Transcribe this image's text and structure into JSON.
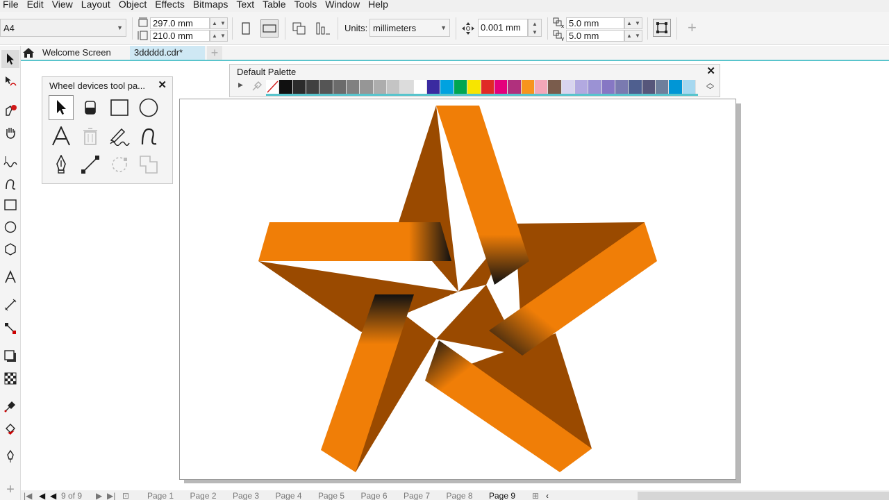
{
  "menu": [
    "File",
    "Edit",
    "View",
    "Layout",
    "Object",
    "Effects",
    "Bitmaps",
    "Text",
    "Table",
    "Tools",
    "Window",
    "Help"
  ],
  "propbar": {
    "page_size": "A4",
    "width": "297.0 mm",
    "height": "210.0 mm",
    "units_label": "Units:",
    "units_value": "millimeters",
    "nudge": "0.001 mm",
    "dup_x": "5.0 mm",
    "dup_y": "5.0 mm"
  },
  "doc_tabs": {
    "welcome": "Welcome Screen",
    "file": "3ddddd.cdr*",
    "add": "+"
  },
  "palette": {
    "title": "Default Palette",
    "colors": [
      "#ffffff",
      "#101010",
      "#2b2b2b",
      "#404040",
      "#555555",
      "#6b6b6b",
      "#808080",
      "#969696",
      "#adadad",
      "#c4c4c4",
      "#dcdcdc",
      "#ffffff",
      "#3a2aa0",
      "#00a2e0",
      "#00a651",
      "#f7e500",
      "#e02a26",
      "#e4007c",
      "#b0307d",
      "#f7941d",
      "#f4a7b9",
      "#7a5c4c",
      "#d8d4ef",
      "#b2a9e0",
      "#9b92d4",
      "#8677c4",
      "#7a7ab0",
      "#4f5f8f",
      "#56567a",
      "#6e7f9c",
      "#0096d6",
      "#a6d8f0"
    ]
  },
  "wheel_panel": {
    "title": "Wheel devices tool pa..."
  },
  "page_nav": {
    "counter": "9 of 9",
    "pages": [
      "Page 1",
      "Page 2",
      "Page 3",
      "Page 4",
      "Page 5",
      "Page 6",
      "Page 7",
      "Page 8",
      "Page 9"
    ],
    "active": "Page 9"
  },
  "colors": {
    "star_light": "#f07e07",
    "star_dark": "#9a4a00",
    "accent": "#59c4cc"
  }
}
